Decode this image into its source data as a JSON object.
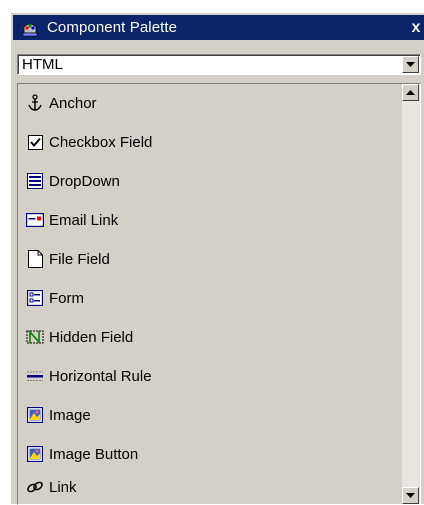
{
  "window": {
    "title": "Component Palette",
    "close_label": "x"
  },
  "category_select": {
    "value": "HTML"
  },
  "components": [
    {
      "label": "Anchor",
      "icon": "anchor-icon"
    },
    {
      "label": "Checkbox Field",
      "icon": "checkbox-icon"
    },
    {
      "label": "DropDown",
      "icon": "dropdown-icon"
    },
    {
      "label": "Email Link",
      "icon": "email-icon"
    },
    {
      "label": "File Field",
      "icon": "file-icon"
    },
    {
      "label": "Form",
      "icon": "form-icon"
    },
    {
      "label": "Hidden Field",
      "icon": "hidden-field-icon"
    },
    {
      "label": "Horizontal Rule",
      "icon": "horizontal-rule-icon"
    },
    {
      "label": "Image",
      "icon": "image-icon"
    },
    {
      "label": "Image Button",
      "icon": "image-button-icon"
    },
    {
      "label": "Link",
      "icon": "link-icon"
    }
  ],
  "colors": {
    "titlebar": "#0a246a",
    "panel": "#d4d0c8"
  }
}
